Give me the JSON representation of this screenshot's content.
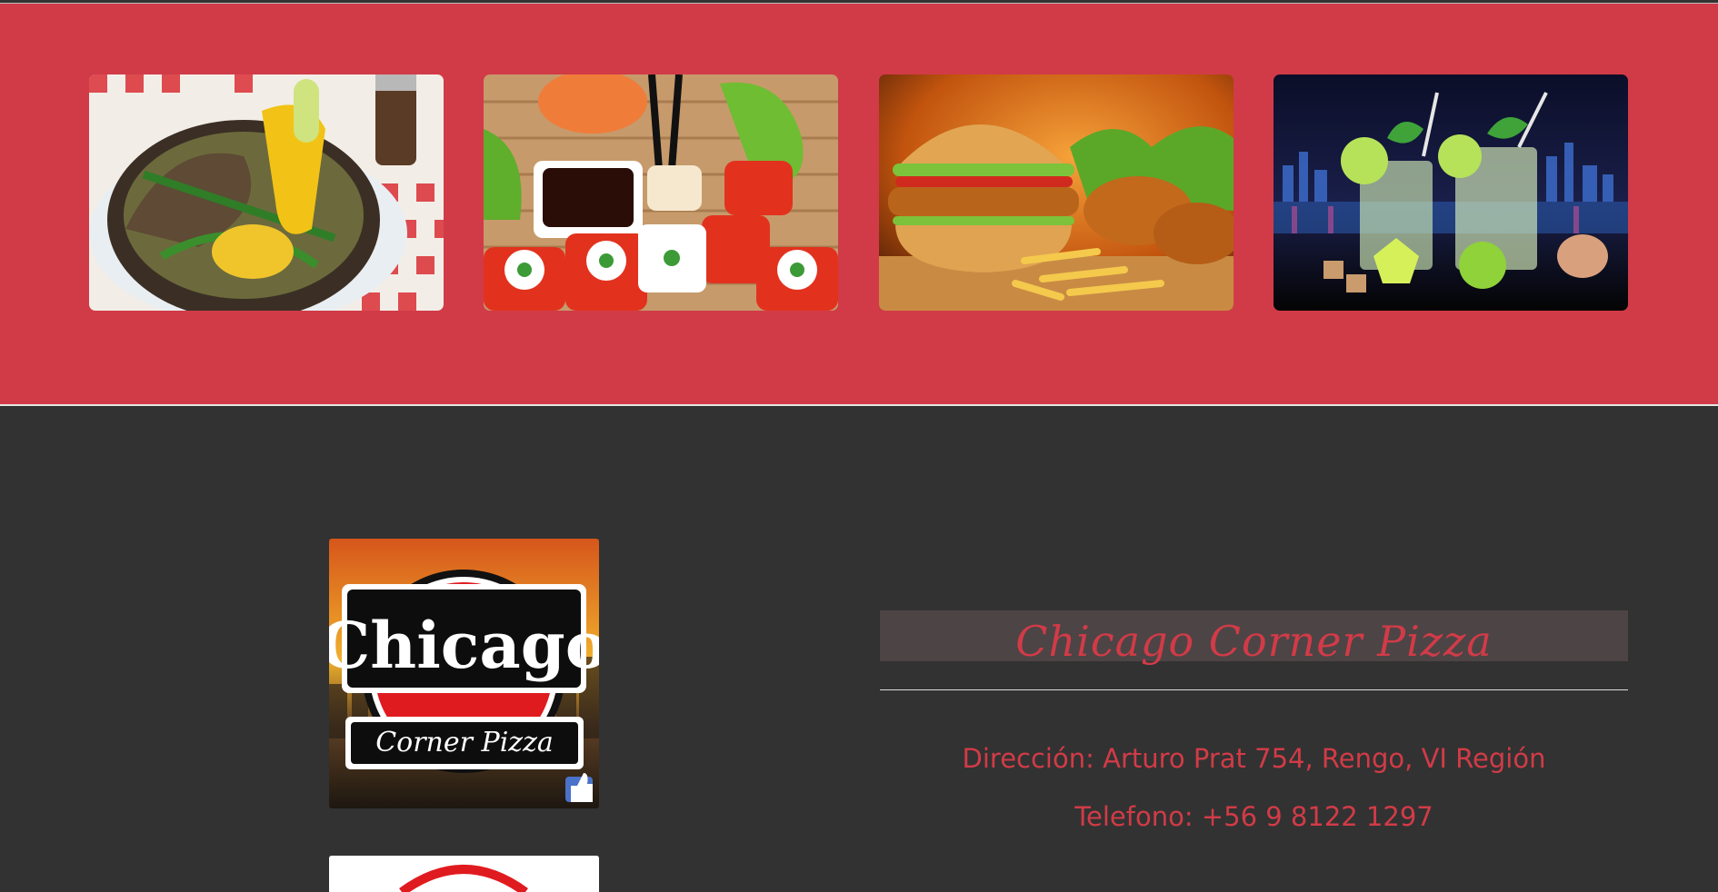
{
  "gallery": {
    "background": "#d13b47",
    "items": [
      {
        "name": "cazuela-soup-image"
      },
      {
        "name": "sushi-image"
      },
      {
        "name": "burger-fries-image"
      },
      {
        "name": "mojito-drinks-image"
      }
    ]
  },
  "footer": {
    "background": "#323232",
    "logo": {
      "word_main": "Chicago",
      "word_sub": "Corner Pizza"
    },
    "title": "Chicago Corner Pizza",
    "address": "Dirección: Arturo Prat 754, Rengo, VI Región",
    "phone": "Telefono: +56 9 8122 1297",
    "accent": "#d13b47"
  }
}
